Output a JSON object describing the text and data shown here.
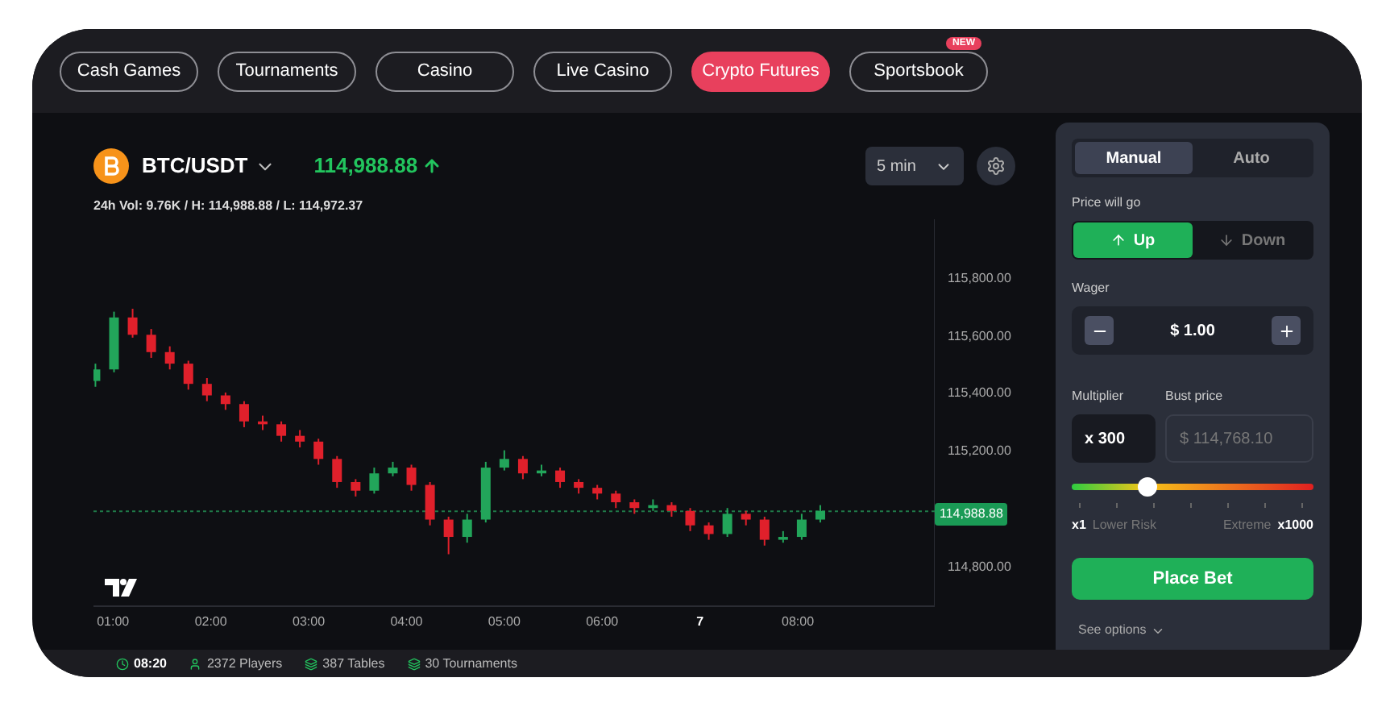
{
  "nav_tabs": [
    {
      "label": "Cash Games",
      "selected": false
    },
    {
      "label": "Tournaments",
      "selected": false
    },
    {
      "label": "Casino",
      "selected": false
    },
    {
      "label": "Live Casino",
      "selected": false
    },
    {
      "label": "Crypto Futures",
      "selected": true
    },
    {
      "label": "Sportsbook",
      "selected": false,
      "badge": "NEW"
    }
  ],
  "market": {
    "pair": "BTC/USDT",
    "price": "114,988.88",
    "stats": "24h Vol: 9.76K / H: 114,988.88 / L: 114,972.37",
    "interval": "5 min"
  },
  "chart": {
    "price_tag": "114,988.88",
    "x_label_styles": [
      {
        "bold": false
      },
      {
        "bold": false
      },
      {
        "bold": false
      },
      {
        "bold": false
      },
      {
        "bold": false
      },
      {
        "bold": false
      },
      {
        "bold": true
      },
      {
        "bold": false
      }
    ],
    "chart_data": {
      "type": "candlestick",
      "ylim": [
        114660,
        116000
      ],
      "xlim": [
        0.8,
        9.4
      ],
      "xticks": [
        {
          "value": 1,
          "label": "01:00"
        },
        {
          "value": 2,
          "label": "02:00"
        },
        {
          "value": 3,
          "label": "03:00"
        },
        {
          "value": 4,
          "label": "04:00"
        },
        {
          "value": 5,
          "label": "05:00"
        },
        {
          "value": 6,
          "label": "06:00"
        },
        {
          "value": 7,
          "label": "7"
        },
        {
          "value": 8,
          "label": "08:00"
        }
      ],
      "ref_lines": [
        {
          "value": 114988.88,
          "axis": "y"
        }
      ],
      "yticks": [
        {
          "value": 115800,
          "label": "115,800.00"
        },
        {
          "value": 115600,
          "label": "115,600.00"
        },
        {
          "value": 115400,
          "label": "115,400.00"
        },
        {
          "value": 115200,
          "label": "115,200.00"
        },
        {
          "value": 114800,
          "label": "114,800.00"
        }
      ],
      "x": [
        0.82,
        1.01,
        1.2,
        1.39,
        1.58,
        1.77,
        1.96,
        2.15,
        2.34,
        2.53,
        2.72,
        2.91,
        3.1,
        3.29,
        3.48,
        3.67,
        3.86,
        4.05,
        4.24,
        4.43,
        4.62,
        4.81,
        5,
        5.19,
        5.38,
        5.57,
        5.76,
        5.95,
        6.14,
        6.33,
        6.52,
        6.71,
        6.9,
        7.09,
        7.28,
        7.47,
        7.66,
        7.85,
        8.04,
        8.23
      ],
      "ohlc": [
        [
          115440,
          115500,
          115420,
          115480
        ],
        [
          115480,
          115680,
          115470,
          115660
        ],
        [
          115660,
          115690,
          115590,
          115600
        ],
        [
          115600,
          115620,
          115520,
          115540
        ],
        [
          115540,
          115560,
          115480,
          115500
        ],
        [
          115500,
          115510,
          115410,
          115430
        ],
        [
          115430,
          115450,
          115370,
          115390
        ],
        [
          115390,
          115400,
          115340,
          115360
        ],
        [
          115360,
          115370,
          115280,
          115300
        ],
        [
          115300,
          115320,
          115270,
          115290
        ],
        [
          115290,
          115300,
          115230,
          115250
        ],
        [
          115250,
          115270,
          115210,
          115230
        ],
        [
          115230,
          115240,
          115150,
          115170
        ],
        [
          115170,
          115180,
          115070,
          115090
        ],
        [
          115090,
          115100,
          115040,
          115060
        ],
        [
          115060,
          115140,
          115050,
          115120
        ],
        [
          115120,
          115160,
          115110,
          115140
        ],
        [
          115140,
          115150,
          115060,
          115080
        ],
        [
          115080,
          115090,
          114940,
          114960
        ],
        [
          114960,
          114970,
          114840,
          114900
        ],
        [
          114900,
          114980,
          114880,
          114960
        ],
        [
          114960,
          115160,
          114950,
          115140
        ],
        [
          115140,
          115200,
          115130,
          115170
        ],
        [
          115170,
          115180,
          115100,
          115120
        ],
        [
          115120,
          115150,
          115110,
          115130
        ],
        [
          115130,
          115140,
          115070,
          115090
        ],
        [
          115090,
          115100,
          115050,
          115070
        ],
        [
          115070,
          115080,
          115030,
          115050
        ],
        [
          115050,
          115060,
          115000,
          115020
        ],
        [
          115020,
          115030,
          114980,
          115000
        ],
        [
          115000,
          115030,
          114990,
          115010
        ],
        [
          115010,
          115020,
          114970,
          114990
        ],
        [
          114990,
          115000,
          114920,
          114940
        ],
        [
          114940,
          114950,
          114890,
          114910
        ],
        [
          114910,
          115000,
          114900,
          114980
        ],
        [
          114980,
          114990,
          114940,
          114960
        ],
        [
          114960,
          114970,
          114870,
          114890
        ],
        [
          114890,
          114920,
          114880,
          114900
        ],
        [
          114900,
          114980,
          114890,
          114960
        ],
        [
          114960,
          115010,
          114950,
          114990
        ]
      ]
    }
  },
  "panel": {
    "modes": [
      {
        "label": "Manual",
        "selected": true
      },
      {
        "label": "Auto",
        "selected": false
      }
    ],
    "direction_label": "Price will go",
    "directions": [
      {
        "label": "Up",
        "kind": "up",
        "selected": true
      },
      {
        "label": "Down",
        "kind": "down",
        "selected": false
      }
    ],
    "wager_label": "Wager",
    "wager": "$ 1.00",
    "multiplier_label": "Multiplier",
    "multiplier": "x 300",
    "bust_label": "Bust price",
    "bust_price": "$ 114,768.10",
    "risk": {
      "level": 0.31,
      "min": "x1",
      "min_label": "Lower Risk",
      "max_label": "Extreme",
      "max": "x1000"
    },
    "place_bet": "Place Bet",
    "see_options": "See options"
  },
  "status_bar": {
    "time": "08:20",
    "players": "2372 Players",
    "tables": "387 Tables",
    "tournaments": "30 Tournaments"
  }
}
